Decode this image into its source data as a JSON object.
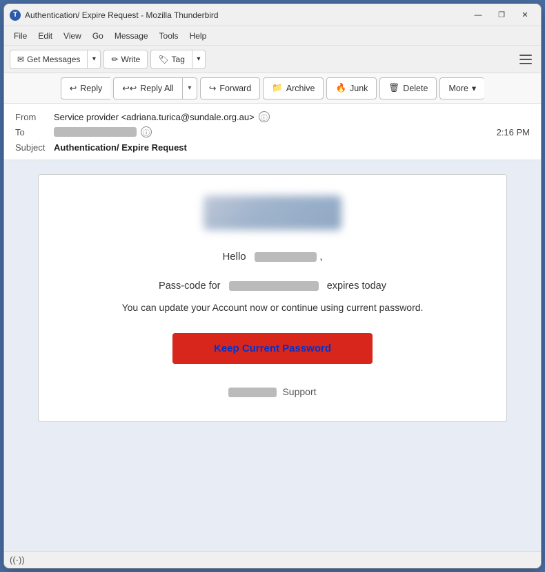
{
  "window": {
    "title": "Authentication/ Expire Request - Mozilla Thunderbird",
    "icon_label": "T",
    "controls": {
      "minimize": "—",
      "maximize": "❐",
      "close": "✕"
    }
  },
  "menu": {
    "items": [
      "File",
      "Edit",
      "View",
      "Go",
      "Message",
      "Tools",
      "Help"
    ]
  },
  "toolbar": {
    "get_messages_label": "Get Messages",
    "write_label": "Write",
    "tag_label": "Tag",
    "hamburger_aria": "Menu"
  },
  "action_bar": {
    "reply_label": "Reply",
    "reply_all_label": "Reply All",
    "forward_label": "Forward",
    "archive_label": "Archive",
    "junk_label": "Junk",
    "delete_label": "Delete",
    "more_label": "More"
  },
  "email_header": {
    "from_label": "From",
    "from_value": "Service provider <adriana.turica@sundale.org.au>",
    "to_label": "To",
    "time": "2:16 PM",
    "subject_label": "Subject",
    "subject_value": "Authentication/ Expire Request"
  },
  "email_body": {
    "hello_prefix": "Hello",
    "hello_suffix": ",",
    "passcode_prefix": "Pass-code for",
    "passcode_suffix": "expires today",
    "description": "You can update your Account now or continue using current password.",
    "cta_button": "Keep Current Password",
    "support_suffix": "Support"
  },
  "status_bar": {
    "wifi_symbol": "((·))"
  }
}
